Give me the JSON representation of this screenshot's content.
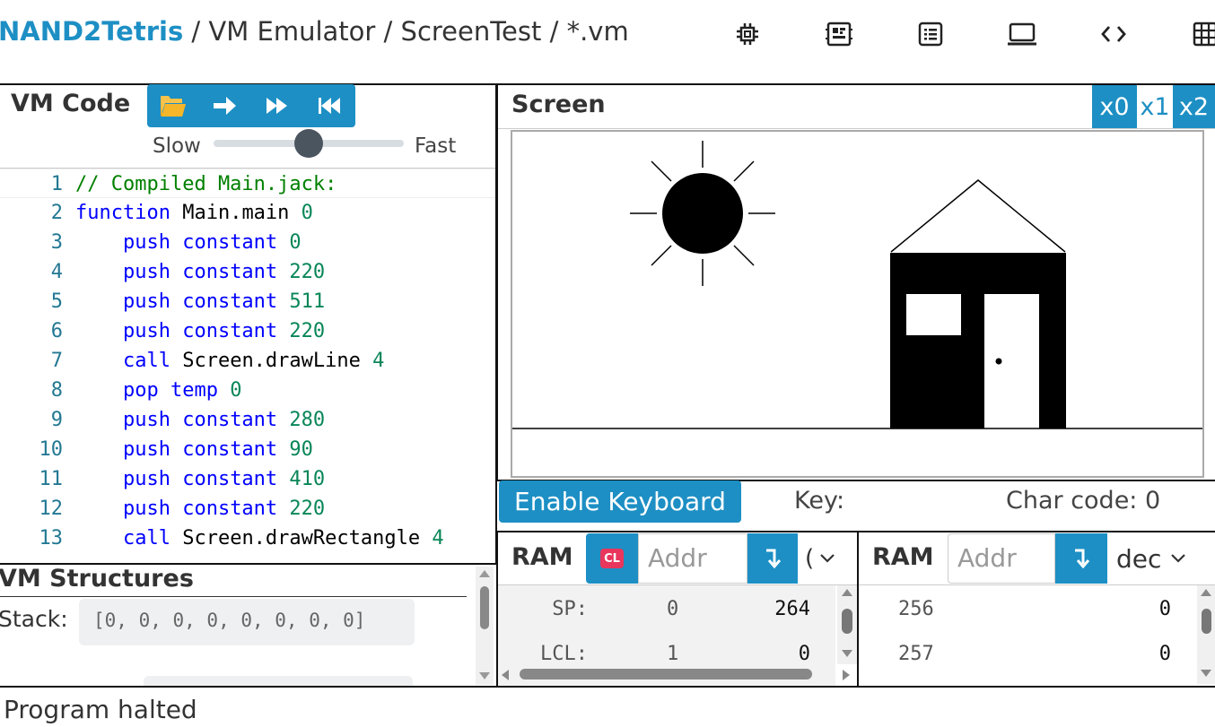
{
  "breadcrumb": {
    "brand": "NAND2Tetris",
    "sep1": "/",
    "tool": "VM Emulator",
    "sep2": "/",
    "project": "ScreenTest",
    "sep3": "/",
    "file": "*.vm"
  },
  "nav_icons": [
    "chip-icon",
    "cpu-icon",
    "list-icon",
    "laptop-icon",
    "code-icon",
    "grid-icon"
  ],
  "vm_code": {
    "title": "VM Code",
    "speed_slow": "Slow",
    "speed_fast": "Fast",
    "speed_level": 0.5,
    "lines": [
      {
        "n": "1",
        "parts": [
          [
            "cmt",
            "// Compiled Main.jack:"
          ]
        ]
      },
      {
        "n": "2",
        "parts": [
          [
            "kw",
            "function"
          ],
          [
            "plain",
            " Main.main "
          ],
          [
            "num",
            "0"
          ]
        ]
      },
      {
        "n": "3",
        "parts": [
          [
            "plain",
            "    "
          ],
          [
            "kw",
            "push constant"
          ],
          [
            "plain",
            " "
          ],
          [
            "num",
            "0"
          ]
        ]
      },
      {
        "n": "4",
        "parts": [
          [
            "plain",
            "    "
          ],
          [
            "kw",
            "push constant"
          ],
          [
            "plain",
            " "
          ],
          [
            "num",
            "220"
          ]
        ]
      },
      {
        "n": "5",
        "parts": [
          [
            "plain",
            "    "
          ],
          [
            "kw",
            "push constant"
          ],
          [
            "plain",
            " "
          ],
          [
            "num",
            "511"
          ]
        ]
      },
      {
        "n": "6",
        "parts": [
          [
            "plain",
            "    "
          ],
          [
            "kw",
            "push constant"
          ],
          [
            "plain",
            " "
          ],
          [
            "num",
            "220"
          ]
        ]
      },
      {
        "n": "7",
        "parts": [
          [
            "plain",
            "    "
          ],
          [
            "kw",
            "call"
          ],
          [
            "plain",
            " Screen.drawLine "
          ],
          [
            "num",
            "4"
          ]
        ]
      },
      {
        "n": "8",
        "parts": [
          [
            "plain",
            "    "
          ],
          [
            "kw",
            "pop temp"
          ],
          [
            "plain",
            " "
          ],
          [
            "num",
            "0"
          ]
        ]
      },
      {
        "n": "9",
        "parts": [
          [
            "plain",
            "    "
          ],
          [
            "kw",
            "push constant"
          ],
          [
            "plain",
            " "
          ],
          [
            "num",
            "280"
          ]
        ]
      },
      {
        "n": "10",
        "parts": [
          [
            "plain",
            "    "
          ],
          [
            "kw",
            "push constant"
          ],
          [
            "plain",
            " "
          ],
          [
            "num",
            "90"
          ]
        ]
      },
      {
        "n": "11",
        "parts": [
          [
            "plain",
            "    "
          ],
          [
            "kw",
            "push constant"
          ],
          [
            "plain",
            " "
          ],
          [
            "num",
            "410"
          ]
        ]
      },
      {
        "n": "12",
        "parts": [
          [
            "plain",
            "    "
          ],
          [
            "kw",
            "push constant"
          ],
          [
            "plain",
            " "
          ],
          [
            "num",
            "220"
          ]
        ]
      },
      {
        "n": "13",
        "parts": [
          [
            "plain",
            "    "
          ],
          [
            "kw",
            "call"
          ],
          [
            "plain",
            " Screen.drawRectangle "
          ],
          [
            "num",
            "4"
          ]
        ]
      }
    ]
  },
  "vm_structures": {
    "title": "VM Structures",
    "stack_label": "Stack:",
    "stack_value": "[0, 0, 0, 0, 0, 0, 0, 0]"
  },
  "screen": {
    "title": "Screen",
    "zoom_options": [
      "x0",
      "x1",
      "x2"
    ],
    "zoom_selected": "x1"
  },
  "keyboard": {
    "enable_label": "Enable Keyboard",
    "key_label": "Key:",
    "char_code_label": "Char code: 0"
  },
  "ram1": {
    "title": "RAM",
    "cl_label": "CL",
    "addr_placeholder": "Addr",
    "format_value": "(",
    "rows": [
      {
        "name": "SP:",
        "addr": "0",
        "value": "264"
      },
      {
        "name": "LCL:",
        "addr": "1",
        "value": "0"
      }
    ]
  },
  "ram2": {
    "title": "RAM",
    "addr_placeholder": "Addr",
    "format_value": "dec",
    "rows": [
      {
        "addr": "256",
        "value": "0"
      },
      {
        "addr": "257",
        "value": "0"
      }
    ]
  },
  "status": "Program halted",
  "colors": {
    "accent": "#1d8fc4",
    "cl_badge": "#e8365d"
  }
}
